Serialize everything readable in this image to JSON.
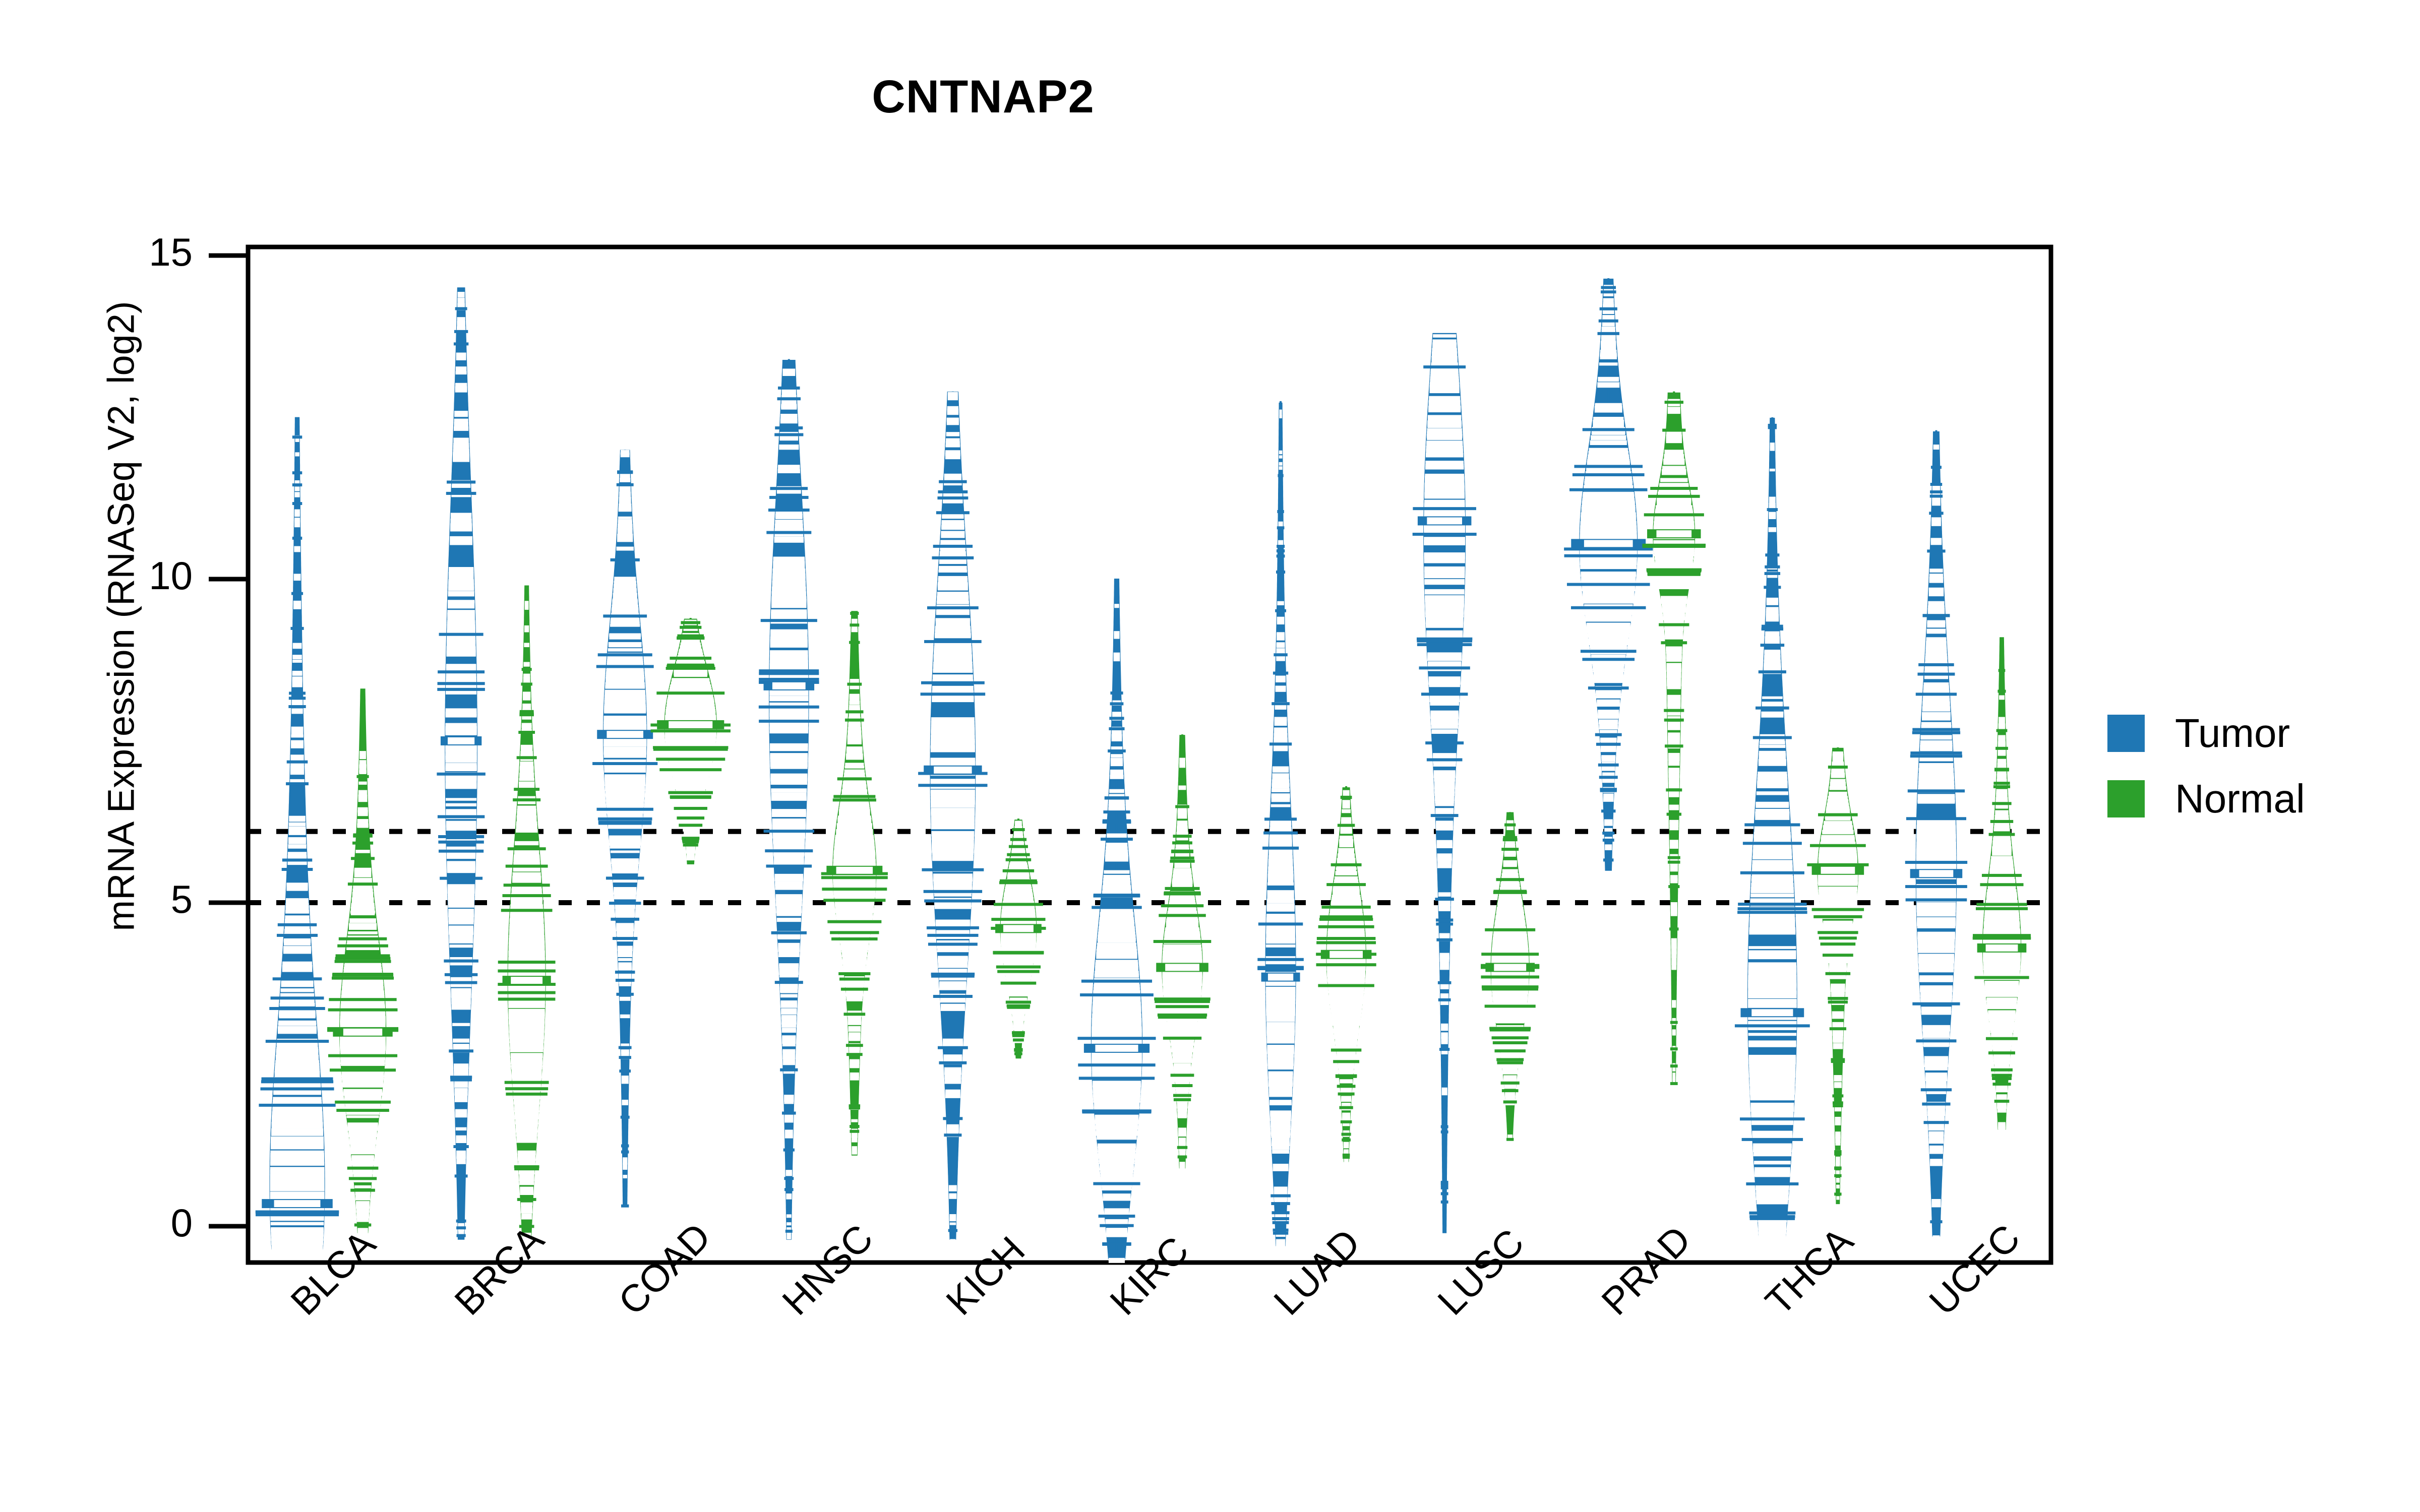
{
  "chart_data": {
    "type": "bar",
    "chart_kind": "beanplot-violin",
    "title": "CNTNAP2",
    "xlabel": "",
    "ylabel": "mRNA Expression (RNASeq V2, log2)",
    "ylim": [
      -0.6,
      15
    ],
    "yticks": [
      0,
      5,
      10,
      15
    ],
    "ytick_labels": [
      "0",
      "5",
      "10",
      "15"
    ],
    "grid": false,
    "legend_position": "right",
    "reference_lines": [
      6.1,
      5.0
    ],
    "reference_line_style": "dotted",
    "categories": [
      "BLCA",
      "BRCA",
      "COAD",
      "HNSC",
      "KICH",
      "KIRC",
      "LUAD",
      "LUSC",
      "PRAD",
      "THCA",
      "UCEC"
    ],
    "series": [
      {
        "name": "Tumor",
        "color": "#1F77B4",
        "medians": [
          0.35,
          7.5,
          7.6,
          8.35,
          7.05,
          2.75,
          3.85,
          10.9,
          10.55,
          3.3,
          5.45
        ],
        "mins": [
          -0.35,
          -0.2,
          0.3,
          -0.2,
          -0.2,
          -0.5,
          -0.3,
          -0.1,
          5.5,
          -0.15,
          -0.15
        ],
        "maxs": [
          12.5,
          14.5,
          12.0,
          13.4,
          12.9,
          10.0,
          12.75,
          13.8,
          14.65,
          12.5,
          12.3
        ],
        "q1": [
          0.05,
          4.4,
          6.6,
          5.3,
          5.0,
          1.6,
          2.6,
          8.0,
          9.6,
          1.3,
          4.0
        ],
        "q3": [
          3.8,
          10.2,
          9.2,
          10.1,
          9.6,
          4.5,
          6.2,
          12.0,
          11.8,
          6.2,
          8.0
        ],
        "widths": [
          0.95,
          0.55,
          0.75,
          0.68,
          0.78,
          0.88,
          0.52,
          0.72,
          1.0,
          0.85,
          0.7
        ]
      },
      {
        "name": "Normal",
        "color": "#2CA02C",
        "medians": [
          3.0,
          3.8,
          7.75,
          5.5,
          4.6,
          4.0,
          4.2,
          4.0,
          10.7,
          5.5,
          4.3
        ],
        "mins": [
          -0.1,
          -0.15,
          5.6,
          1.1,
          2.6,
          0.9,
          1.0,
          1.35,
          2.2,
          0.35,
          1.5
        ],
        "maxs": [
          8.3,
          9.9,
          9.4,
          9.5,
          6.3,
          7.6,
          6.8,
          6.4,
          12.9,
          7.4,
          9.1
        ],
        "q1": [
          2.0,
          2.3,
          7.1,
          4.7,
          4.0,
          3.4,
          3.4,
          3.3,
          10.1,
          4.8,
          3.6
        ],
        "q3": [
          4.1,
          5.3,
          8.4,
          6.2,
          5.2,
          4.8,
          5.0,
          4.8,
          11.3,
          6.0,
          5.2
        ],
        "widths": [
          0.8,
          0.65,
          0.9,
          0.75,
          0.62,
          0.7,
          0.68,
          0.66,
          0.72,
          0.7,
          0.66
        ]
      }
    ]
  },
  "legend": {
    "items": [
      {
        "label": "Tumor",
        "color": "#1F77B4"
      },
      {
        "label": "Normal",
        "color": "#2CA02C"
      }
    ]
  },
  "axes": {
    "y_label": "mRNA Expression (RNASeq V2, log2)",
    "y_tick_labels": [
      "15",
      "10",
      "5",
      "0"
    ],
    "x_tick_labels": [
      "BLCA",
      "BRCA",
      "COAD",
      "HNSC",
      "KICH",
      "KIRC",
      "LUAD",
      "LUSC",
      "PRAD",
      "THCA",
      "UCEC"
    ]
  },
  "title": "CNTNAP2"
}
